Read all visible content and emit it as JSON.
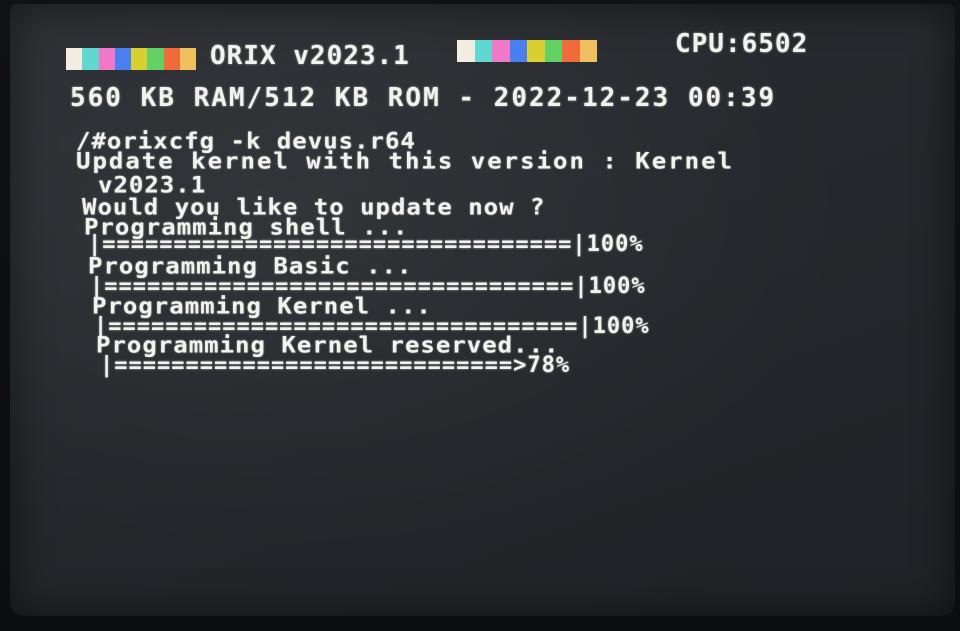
{
  "header": {
    "title": "ORIX v2023.1",
    "cpu": "CPU:6502",
    "info": "560 KB RAM/512 KB ROM - 2022-12-23 00:39",
    "stripe_colors": [
      "#f2ede0",
      "#60d8d0",
      "#f078c8",
      "#4a7ff0",
      "#d8d030",
      "#62d062",
      "#f06a3a",
      "#f0c060"
    ]
  },
  "terminal": {
    "command": "/#orixcfg -k devus.r64",
    "line_update": "Update kernel with this version : Kernel",
    "line_version": "v2023.1",
    "line_prompt": "Would you like to update now ?",
    "steps": [
      {
        "label": "Programming shell ...",
        "bar": "|=================================|100%",
        "progress": 100
      },
      {
        "label": "Programming Basic ...",
        "bar": "|=================================|100%",
        "progress": 100
      },
      {
        "label": "Programming Kernel ...",
        "bar": "|=================================|100%",
        "progress": 100
      },
      {
        "label": "Programming Kernel reserved...",
        "bar": "|============================>78%",
        "progress": 78
      }
    ]
  }
}
